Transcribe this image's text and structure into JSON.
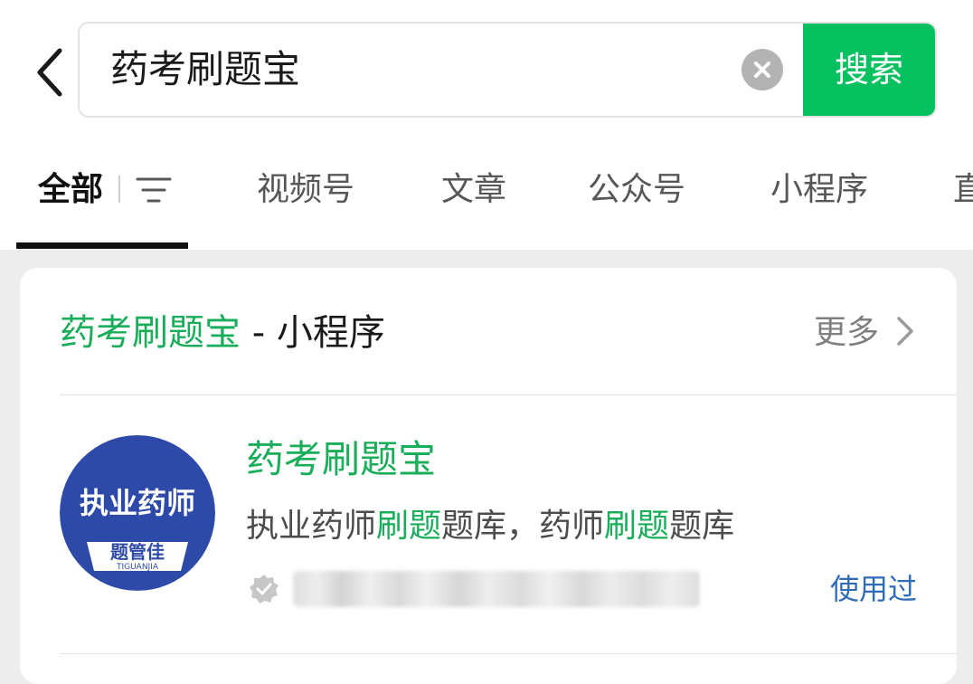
{
  "search": {
    "query": "药考刷题宝",
    "button_label": "搜索"
  },
  "tabs": [
    {
      "label": "全部",
      "active": true
    },
    {
      "label": "视频号",
      "active": false
    },
    {
      "label": "文章",
      "active": false
    },
    {
      "label": "公众号",
      "active": false
    },
    {
      "label": "小程序",
      "active": false
    },
    {
      "label": "直",
      "active": false
    }
  ],
  "section": {
    "title_highlight": "药考刷题宝",
    "title_suffix": " - 小程序",
    "more_label": "更多"
  },
  "result": {
    "name": "药考刷题宝",
    "description_parts": [
      "执业药师",
      "刷题",
      "题库，药师",
      "刷题",
      "题库"
    ],
    "status": "使用过",
    "logo": {
      "main_text": "执业药师",
      "brand_cn": "题管佳",
      "brand_en": "TIGUANJIA"
    }
  },
  "colors": {
    "accent": "#07c160",
    "highlight_text": "#1aad5a",
    "link_blue": "#2f6cb8",
    "logo_blue": "#2e4aa8",
    "background": "#ededed"
  },
  "icons": {
    "back": "back-chevron-icon",
    "clear": "clear-circle-x-icon",
    "filter": "filter-lines-icon",
    "more": "chevron-right-icon",
    "verified": "verified-badge-icon"
  }
}
